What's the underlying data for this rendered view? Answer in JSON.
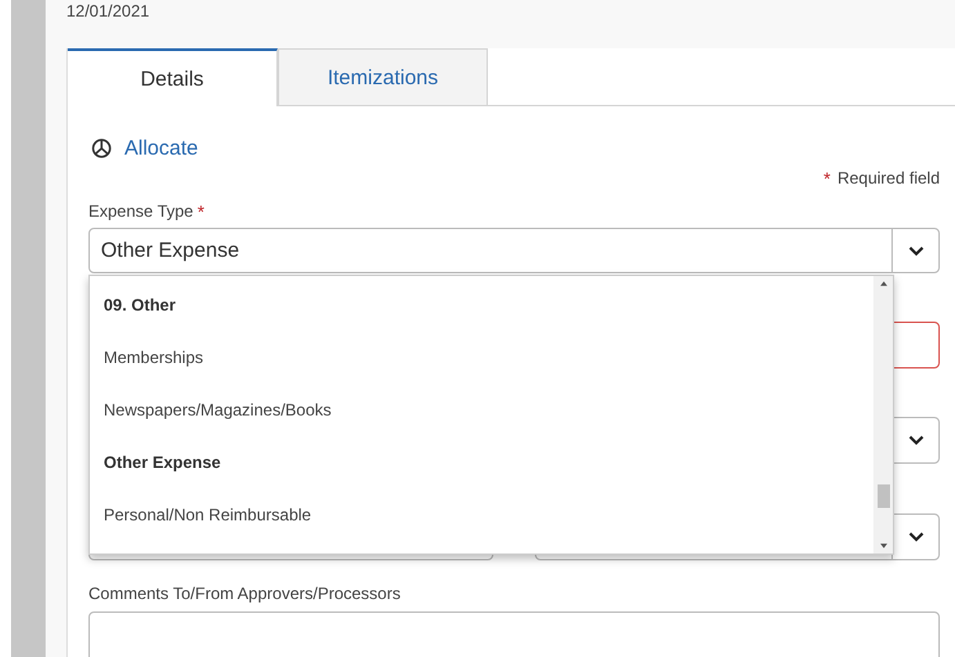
{
  "date": "12/01/2021",
  "tabs": [
    {
      "label": "Details",
      "selected": true
    },
    {
      "label": "Itemizations",
      "selected": false
    }
  ],
  "allocate": {
    "label": "Allocate"
  },
  "required_note": {
    "mark": "*",
    "text": "Required field"
  },
  "expense_type": {
    "label": "Expense Type",
    "mark": "*",
    "value": "Other Expense",
    "expanded": true
  },
  "dropdown_items": [
    {
      "kind": "header",
      "label": "09. Other"
    },
    {
      "kind": "option",
      "label": "Memberships"
    },
    {
      "kind": "option",
      "label": "Newspapers/Magazines/Books"
    },
    {
      "kind": "header",
      "label": "Other Expense"
    },
    {
      "kind": "option",
      "label": "Personal/Non Reimbursable"
    }
  ],
  "comments": {
    "label": "Comments To/From Approvers/Processors"
  }
}
